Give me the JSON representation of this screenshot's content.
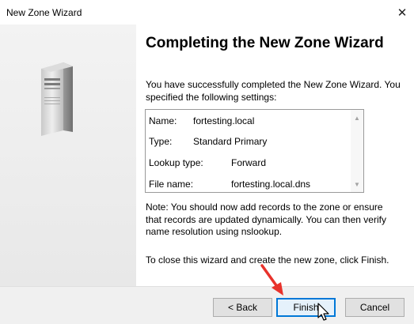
{
  "window": {
    "title": "New Zone Wizard"
  },
  "icons": {
    "close": "close-icon",
    "server": "server-icon",
    "cursor": "mouse-pointer-icon",
    "annotation": "red-arrow-icon"
  },
  "heading": "Completing the New Zone Wizard",
  "intro_line1": "You have successfully completed the New Zone Wizard. You",
  "intro_line2": "specified the following settings:",
  "settings": [
    {
      "label": "Name:",
      "value": "fortesting.local"
    },
    {
      "label": "Type:",
      "value": "Standard Primary"
    },
    {
      "label": "Lookup type:",
      "value": "Forward"
    },
    {
      "label": "File name:",
      "value": "fortesting.local.dns"
    }
  ],
  "note_line1": "Note: You should now add records to the zone or ensure",
  "note_line2": "that records are updated dynamically. You can then verify",
  "note_line3": "name resolution using nslookup.",
  "close_instruction": "To close this wizard and create the new zone, click Finish.",
  "buttons": {
    "back": "< Back",
    "finish": "Finish",
    "cancel": "Cancel"
  },
  "colors": {
    "focus_border": "#0078d7",
    "annotation_red": "#e8322b"
  }
}
